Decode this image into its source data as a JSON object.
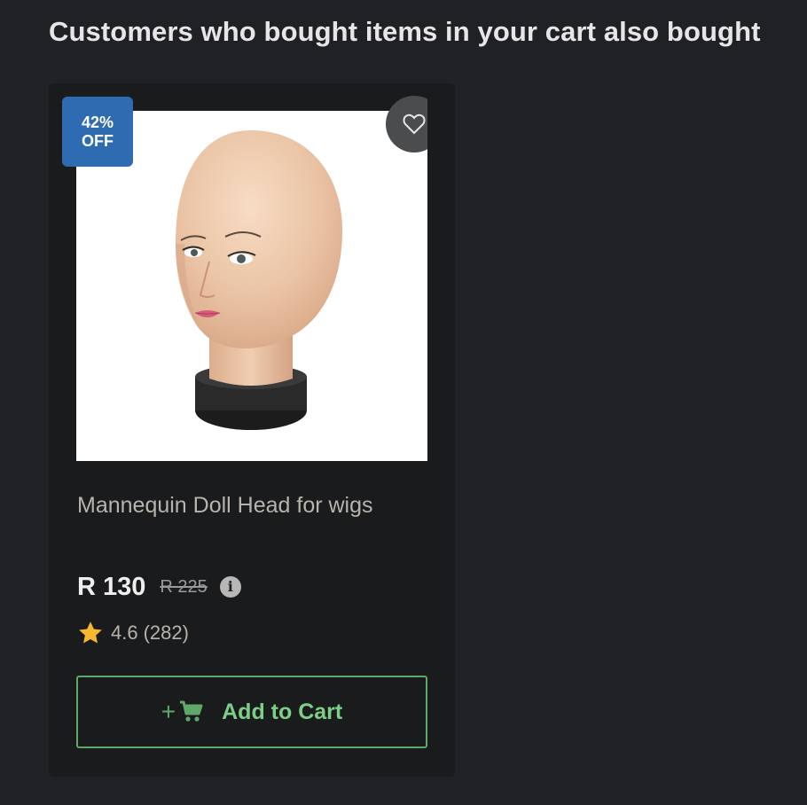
{
  "section": {
    "title": "Customers who bought items in your cart also bought"
  },
  "product": {
    "badge_percent": "42%",
    "badge_off": "OFF",
    "name": "Mannequin Doll Head for wigs",
    "price": "R 130",
    "original_price": "R 225",
    "rating": "4.6",
    "review_count": "(282)",
    "add_to_cart_label": "Add to Cart",
    "plus_symbol": "+",
    "wishlist_icon": "heart-outline-icon",
    "info_icon": "info-icon",
    "star_icon": "star-icon",
    "cart_icon": "shopping-cart-icon"
  },
  "colors": {
    "background": "#202124",
    "card": "#1a1b1d",
    "badge": "#2e6bb0",
    "accent_green": "#7ccf86",
    "button_border": "#5fa86a",
    "star": "#f5b82e"
  }
}
